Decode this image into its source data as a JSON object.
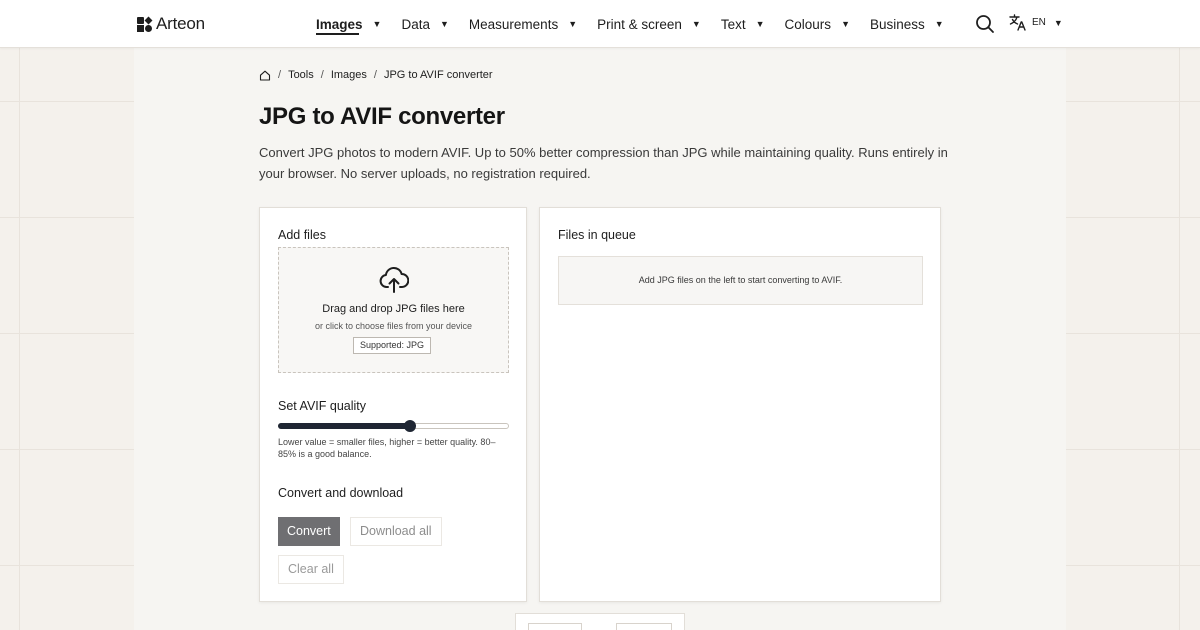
{
  "brand": {
    "name": "Arteon",
    "icon": "arteon-logo-icon"
  },
  "nav": {
    "items": [
      {
        "label": "Images",
        "active": true
      },
      {
        "label": "Data",
        "active": false
      },
      {
        "label": "Measurements",
        "active": false
      },
      {
        "label": "Print & screen",
        "active": false
      },
      {
        "label": "Text",
        "active": false
      },
      {
        "label": "Colours",
        "active": false
      },
      {
        "label": "Business",
        "active": false
      }
    ],
    "caret": "▼",
    "search_icon": "search-icon",
    "language": {
      "code": "EN",
      "icon": "translate-icon"
    }
  },
  "breadcrumb": {
    "home_icon": "home-icon",
    "separator": "/",
    "items": [
      "Tools",
      "Images",
      "JPG to AVIF converter"
    ]
  },
  "page": {
    "title": "JPG to AVIF converter",
    "description": "Convert JPG photos to modern AVIF. Up to 50% better compression than JPG while maintaining quality. Runs entirely in your browser. No server uploads, no registration required."
  },
  "add_files": {
    "title": "Add files",
    "upload_icon": "cloud-upload-icon",
    "drop_text": "Drag and drop JPG files here",
    "drop_subtext": "or click to choose files from your device",
    "supported_badge": "Supported: JPG"
  },
  "quality": {
    "title": "Set AVIF quality",
    "value_fraction": 0.57,
    "hint": "Lower value = smaller files, higher = better quality. 80–85% is a good balance."
  },
  "convert": {
    "title": "Convert and download",
    "convert_label": "Convert",
    "download_all_label": "Download all",
    "clear_all_label": "Clear all"
  },
  "queue": {
    "title": "Files in queue",
    "empty_message": "Add JPG files on the left to start converting to AVIF."
  },
  "colors": {
    "page_bg": "#f4f1ec",
    "slider_accent": "#1f2633",
    "primary_button": "#6f6f72"
  }
}
